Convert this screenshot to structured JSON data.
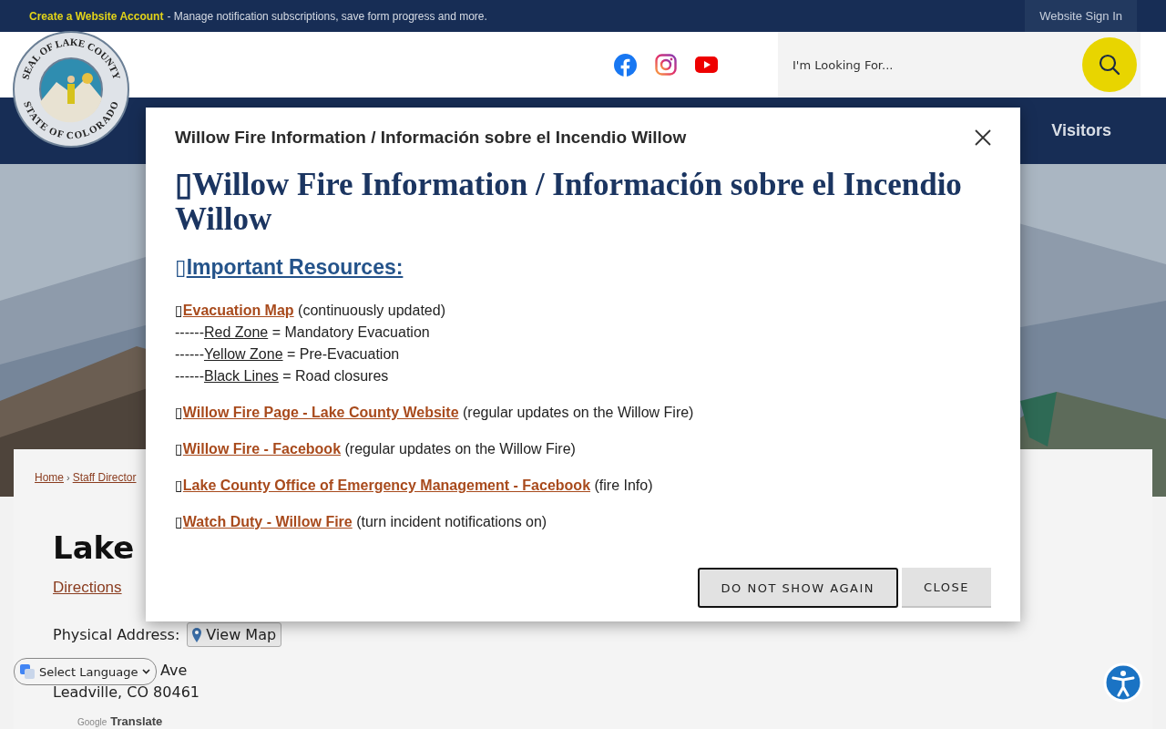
{
  "top_bar": {
    "account_link": "Create a Website Account",
    "account_text": "- Manage notification subscriptions, save form progress and more.",
    "sign_in": "Website Sign In"
  },
  "header": {
    "seal_top": "SEAL OF LAKE COUNTY",
    "seal_bottom": "STATE OF COLORADO",
    "search": {
      "placeholder": "I'm Looking For..."
    }
  },
  "nav": {
    "items": [
      "Visitors"
    ]
  },
  "content": {
    "breadcrumbs": [
      "Home",
      "Staff Director"
    ],
    "separator": "›",
    "heading": "Lake",
    "directions": "Directions",
    "physical_label": "Physical Address:",
    "view_map": "View Map",
    "address_lines": [
      "Ave",
      "Leadville, CO 80461"
    ]
  },
  "language": {
    "select": "Select Language",
    "google": "Google",
    "translate": "Translate"
  },
  "modal": {
    "title": "Willow Fire Information / Información sobre el Incendio Willow",
    "heading": "Willow Fire Information / Información sobre el Incendio Willow",
    "mark": "▯",
    "subheading": "Important Resources:",
    "evac": {
      "link": "Evacuation Map",
      "note": "(continuously updated)"
    },
    "legend": [
      {
        "dashes": "------",
        "term": "Red Zone",
        "meaning": "= Mandatory Evacuation"
      },
      {
        "dashes": "------",
        "term": "Yellow Zone",
        "meaning": "= Pre-Evacuation"
      },
      {
        "dashes": "------",
        "term": "Black Lines",
        "meaning": "= Road closures"
      }
    ],
    "resources": [
      {
        "link": "Willow Fire Page - Lake County Website",
        "note": "(regular updates on the Willow Fire)"
      },
      {
        "link": "Willow Fire - Facebook",
        "note": "(regular updates on the Willow Fire)"
      },
      {
        "link": "Lake County Office of Emergency Management - Facebook",
        "note": "(fire Info)"
      },
      {
        "link": "Watch Duty - Willow Fire",
        "note": "(turn incident notifications on)"
      }
    ],
    "buttons": [
      {
        "label": "DO NOT SHOW AGAIN",
        "kind": "outlined"
      },
      {
        "label": "CLOSE",
        "kind": "plain"
      }
    ]
  }
}
